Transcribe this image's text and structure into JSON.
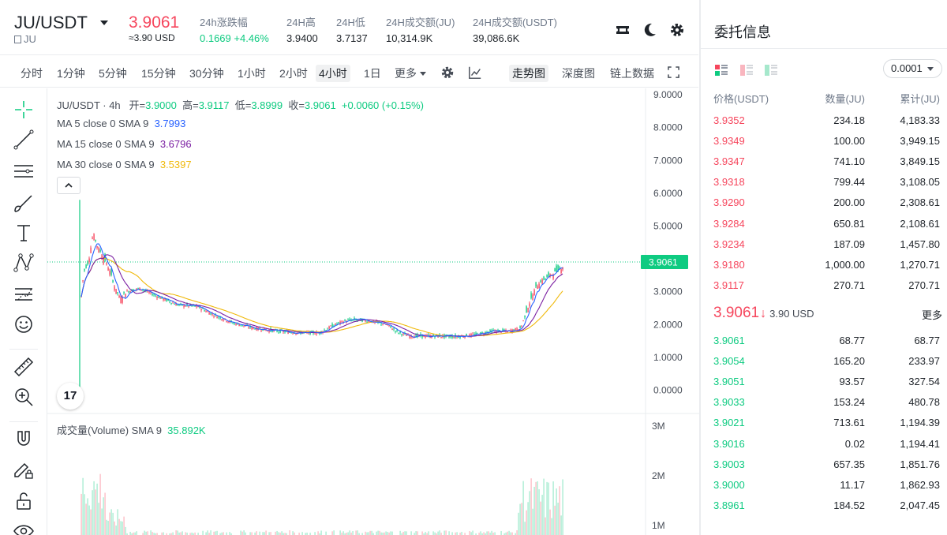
{
  "header": {
    "pair": "JU/USDT",
    "pair_sub": "JU",
    "last_price": "3.9061",
    "last_price_usd": "≈3.90 USD",
    "stats": [
      {
        "label": "24h涨跌幅",
        "value": "0.1669 +4.46%"
      },
      {
        "label": "24H高",
        "value": "3.9400"
      },
      {
        "label": "24H低",
        "value": "3.7137"
      },
      {
        "label": "24H成交额(JU)",
        "value": "10,314.9K"
      },
      {
        "label": "24H成交额(USDT)",
        "value": "39,086.6K"
      }
    ]
  },
  "timeframes": [
    "分时",
    "1分钟",
    "5分钟",
    "15分钟",
    "30分钟",
    "1小时",
    "2小时",
    "4小时",
    "1日",
    "更多"
  ],
  "active_timeframe": "4小时",
  "view_tabs": [
    "走势图",
    "深度图",
    "链上数据"
  ],
  "active_view": "走势图",
  "tools": [
    "crosshair-icon",
    "trend-line-icon",
    "horizontal-lines-icon",
    "brush-icon",
    "text-icon",
    "pattern-icon",
    "forecast-icon",
    "emoji-icon",
    "ruler-icon",
    "zoom-in-icon",
    "magnet-icon",
    "lock-drawing-icon",
    "unlock-icon",
    "eye-icon"
  ],
  "chart": {
    "ohlc": {
      "symbol": "JU/USDT · 4h",
      "open_label": "开=",
      "open": "3.9000",
      "high_label": "高=",
      "high": "3.9117",
      "low_label": "低=",
      "low": "3.8999",
      "close_label": "收=",
      "close": "3.9061",
      "change": "+0.0060 (+0.15%)"
    },
    "mas": [
      {
        "label": "MA 5 close 0 SMA 9",
        "value": "3.7993",
        "color": "#2962ff"
      },
      {
        "label": "MA 15 close 0 SMA 9",
        "value": "3.6796",
        "color": "#7b1fa2"
      },
      {
        "label": "MA 30 close 0 SMA 9",
        "value": "3.5397",
        "color": "#f0b90b"
      }
    ],
    "price_axis": [
      "9.0000",
      "8.0000",
      "7.0000",
      "6.0000",
      "5.0000",
      "3.0000",
      "2.0000",
      "1.0000",
      "0.0000"
    ],
    "price_ticks": [
      9,
      8,
      7,
      6,
      5,
      3,
      2,
      1,
      0
    ],
    "last_price_tag": "3.9061",
    "last_price_value": 3.9061,
    "volume_label": "成交量(Volume) SMA 9",
    "volume_value": "35.892K",
    "volume_axis": [
      "3M",
      "2M",
      "1M"
    ],
    "colors": {
      "up": "#0ecb81",
      "down": "#f6465d",
      "ma5": "#2962ff",
      "ma15": "#7b1fa2",
      "ma30": "#f0b90b"
    }
  },
  "orderbook": {
    "title": "委托信息",
    "precision": "0.0001",
    "col_price": "价格(USDT)",
    "col_qty": "数量(JU)",
    "col_total": "累计(JU)",
    "asks": [
      {
        "p": "3.9352",
        "q": "234.18",
        "t": "4,183.33"
      },
      {
        "p": "3.9349",
        "q": "100.00",
        "t": "3,949.15"
      },
      {
        "p": "3.9347",
        "q": "741.10",
        "t": "3,849.15"
      },
      {
        "p": "3.9318",
        "q": "799.44",
        "t": "3,108.05"
      },
      {
        "p": "3.9290",
        "q": "200.00",
        "t": "2,308.61"
      },
      {
        "p": "3.9284",
        "q": "650.81",
        "t": "2,108.61"
      },
      {
        "p": "3.9234",
        "q": "187.09",
        "t": "1,457.80"
      },
      {
        "p": "3.9180",
        "q": "1,000.00",
        "t": "1,270.71"
      },
      {
        "p": "3.9117",
        "q": "270.71",
        "t": "270.71"
      }
    ],
    "mid_price": "3.9061",
    "mid_arrow": "↓",
    "mid_usd": "3.90 USD",
    "more": "更多",
    "bids": [
      {
        "p": "3.9061",
        "q": "68.77",
        "t": "68.77"
      },
      {
        "p": "3.9054",
        "q": "165.20",
        "t": "233.97"
      },
      {
        "p": "3.9051",
        "q": "93.57",
        "t": "327.54"
      },
      {
        "p": "3.9033",
        "q": "153.24",
        "t": "480.78"
      },
      {
        "p": "3.9021",
        "q": "713.61",
        "t": "1,194.39"
      },
      {
        "p": "3.9016",
        "q": "0.02",
        "t": "1,194.41"
      },
      {
        "p": "3.9003",
        "q": "657.35",
        "t": "1,851.76"
      },
      {
        "p": "3.9000",
        "q": "11.17",
        "t": "1,862.93"
      },
      {
        "p": "3.8961",
        "q": "184.52",
        "t": "2,047.45"
      }
    ]
  }
}
